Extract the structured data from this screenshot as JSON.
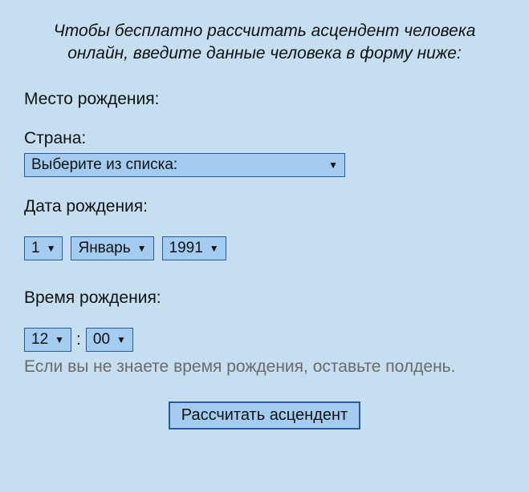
{
  "intro": "Чтобы бесплатно рассчитать асцендент человека онлайн, введите данные человека в форму ниже:",
  "birthplace": {
    "label": "Место рождения:"
  },
  "country": {
    "label": "Страна:",
    "selected": "Выберите из списка:"
  },
  "birthdate": {
    "label": "Дата рождения:",
    "day": "1",
    "month": "Январь",
    "year": "1991"
  },
  "birthtime": {
    "label": "Время рождения:",
    "hour": "12",
    "minute": "00",
    "hint": "Если вы не знаете время рождения, оставьте полдень."
  },
  "submit": {
    "label": "Рассчитать асцендент"
  }
}
